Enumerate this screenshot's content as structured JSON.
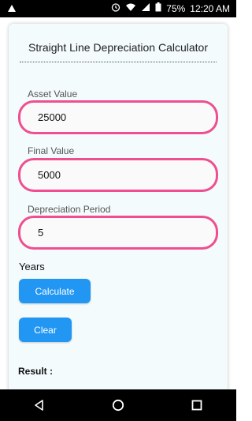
{
  "status_bar": {
    "battery": "75%",
    "time": "12:20 AM"
  },
  "card": {
    "title": "Straight Line Depreciation Calculator"
  },
  "fields": {
    "asset_value": {
      "label": "Asset Value",
      "value": "25000"
    },
    "final_value": {
      "label": "Final Value",
      "value": "5000"
    },
    "period": {
      "label": "Depreciation Period",
      "value": "5"
    }
  },
  "years_label": "Years",
  "buttons": {
    "calculate": "Calculate",
    "clear": "Clear"
  },
  "result_label": "Result :",
  "colors": {
    "accent_pink": "#ef4f91",
    "button_blue": "#2196f3"
  }
}
